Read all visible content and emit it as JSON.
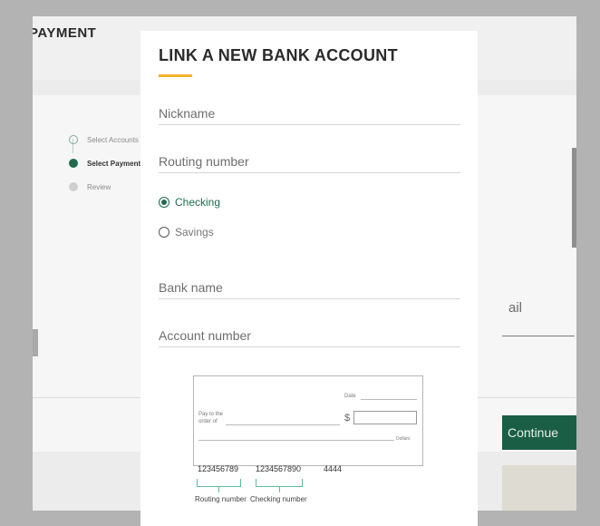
{
  "background": {
    "page_title": "PAYMENT",
    "steps": [
      {
        "label": "Select Accounts",
        "state": "done"
      },
      {
        "label": "Select Payment I",
        "state": "active"
      },
      {
        "label": "Review",
        "state": "pending"
      }
    ],
    "email_label": "ail",
    "continue_label": "Continue"
  },
  "modal": {
    "title": "LINK A NEW BANK ACCOUNT",
    "accent_color": "#f3b22c",
    "fields": {
      "nickname": {
        "placeholder": "Nickname",
        "value": ""
      },
      "routing_number": {
        "placeholder": "Routing number",
        "value": ""
      },
      "bank_name": {
        "placeholder": "Bank name",
        "value": ""
      },
      "account_number": {
        "placeholder": "Account number",
        "value": ""
      }
    },
    "account_type": {
      "options": [
        "Checking",
        "Savings"
      ],
      "selected": "Checking"
    },
    "check_image": {
      "date_label": "Date",
      "pay_to_label_line1": "Pay to the",
      "pay_to_label_line2": "order of",
      "dollar_sign": "$",
      "dollars_label": "Dollars",
      "routing_digits": "123456789",
      "checking_digits": "1234567890",
      "check_digits": "4444",
      "routing_caption": "Routing number",
      "checking_caption": "Checking number"
    }
  },
  "colors": {
    "primary_green": "#1f6b4e",
    "bracket_teal": "#5bbc9e"
  }
}
